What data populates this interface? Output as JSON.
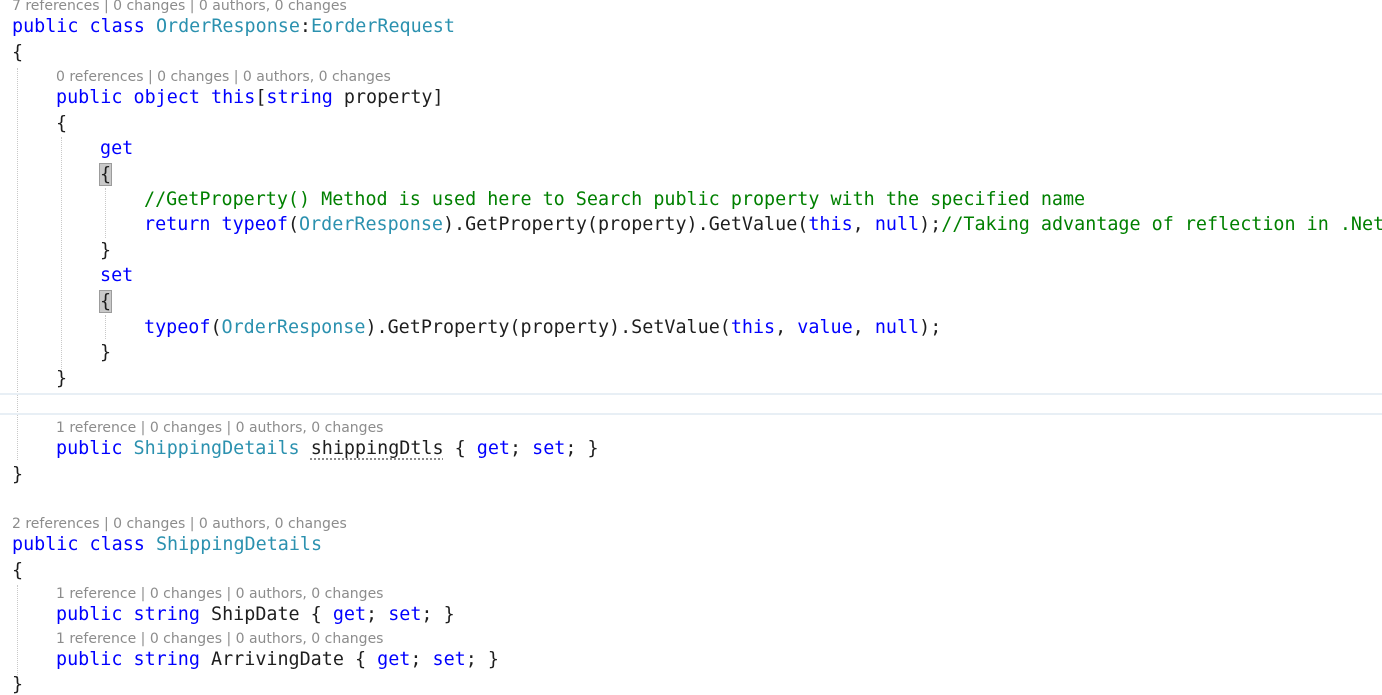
{
  "lens": {
    "order_response_class": "7 references | 0 changes | 0 authors, 0 changes",
    "indexer": "0 references | 0 changes | 0 authors, 0 changes",
    "shipping_dtls_prop": "1 reference | 0 changes | 0 authors, 0 changes",
    "shipping_details_class": "2 references | 0 changes | 0 authors, 0 changes",
    "ship_date_prop": "1 reference | 0 changes | 0 authors, 0 changes",
    "arriving_date_prop": "1 reference | 0 changes | 0 authors, 0 changes"
  },
  "code": {
    "kw_public": "public",
    "kw_class": "class",
    "kw_object": "object",
    "kw_this": "this",
    "kw_string": "string",
    "kw_get": "get",
    "kw_set": "set",
    "kw_return": "return",
    "kw_typeof": "typeof",
    "kw_null": "null",
    "kw_value": "value",
    "order_response": "OrderResponse",
    "eorder_request": "EorderRequest",
    "shipping_details": "ShippingDetails",
    "open_brace": "{",
    "close_brace": "}",
    "colon": ":",
    "indexer_open": "[",
    "indexer_param": " property]",
    "comment_get_property": "//GetProperty() Method is used here to Search public property with the specified name",
    "comment_reflection": "//Taking advantage of reflection in .Net",
    "get_value_call": ").GetProperty(property).GetValue(",
    "set_value_call": ").GetProperty(property).SetValue(",
    "open_paren": "(",
    "comma_space": ", ",
    "get_return_tail": ");",
    "set_tail": ");",
    "shipping_dtls_name": "shippingDtls",
    "auto_prop_open": " { ",
    "auto_prop_sep": "; ",
    "auto_prop_close": "; }",
    "ship_date": "ShipDate",
    "arriving_date": "ArrivingDate"
  },
  "colors": {
    "keyword": "#0000ff",
    "type": "#2b91af",
    "comment": "#008000",
    "text": "#1e1e1e",
    "codelens": "#8c8c8c"
  }
}
